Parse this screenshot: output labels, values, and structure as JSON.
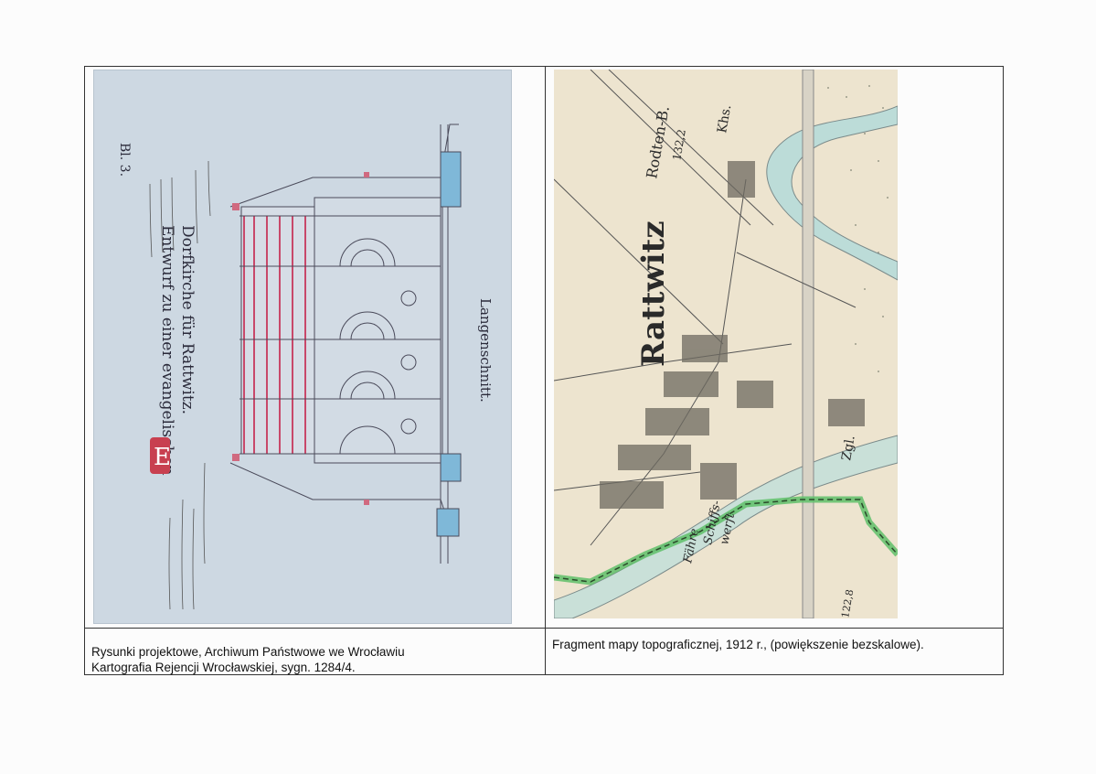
{
  "left": {
    "image": {
      "title_line1": "Entwurf zu einer evangelischen",
      "title_line2": "Dorfkirche für Rattwitz.",
      "section_label": "Langenschnitt.",
      "sheet_no": "Bl. 3."
    },
    "caption_line1": "Rysunki projektowe, Archiwum Państwowe we Wrocławiu",
    "caption_line2": "Kartografia Rejencji Wrocławskiej, sygn. 1284/4."
  },
  "right": {
    "image": {
      "town": "Rattwitz",
      "label_top": "Rodten-B.",
      "spot_height_1": "132,2",
      "label_khs": "Khs.",
      "label_zgl": "Zgl.",
      "label_faehre": "Fähre",
      "label_schiffs": "Schiffs-",
      "label_werft": "werft",
      "spot_height_2": "122,8"
    },
    "caption": "Fragment mapy topograficznej, 1912 r., (powiększenie bezskalowe)."
  },
  "colors": {
    "paper_blue": "#cdd8e2",
    "map_paper": "#ede4cf",
    "water": "#bcdcd8",
    "border_green": "#5fc06a",
    "line_red": "#c8486a"
  }
}
